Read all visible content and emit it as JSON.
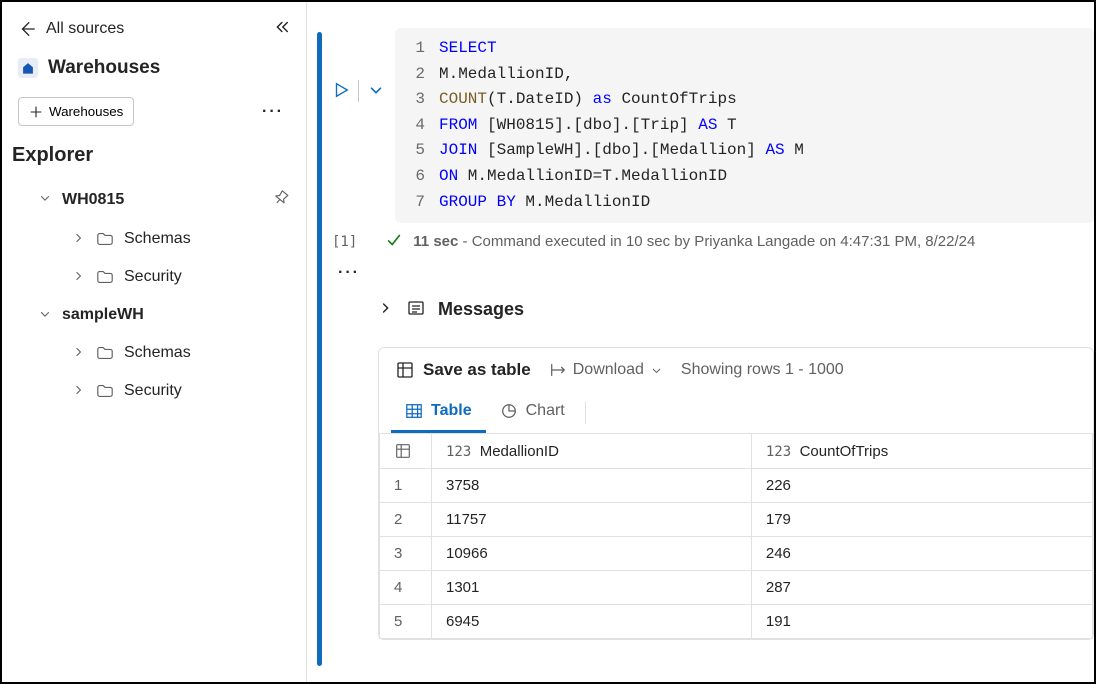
{
  "sidebar": {
    "all_sources_label": "All sources",
    "home_label": "Warehouses",
    "add_button_label": "Warehouses",
    "explorer_label": "Explorer",
    "tree": [
      {
        "name": "WH0815",
        "expanded": true,
        "children": [
          {
            "label": "Schemas"
          },
          {
            "label": "Security"
          }
        ]
      },
      {
        "name": "sampleWH",
        "expanded": true,
        "children": [
          {
            "label": "Schemas"
          },
          {
            "label": "Security"
          }
        ]
      }
    ]
  },
  "query": {
    "lines": [
      {
        "n": "1",
        "parts": [
          {
            "c": "kw",
            "t": "SELECT"
          }
        ]
      },
      {
        "n": "2",
        "parts": [
          {
            "c": "op",
            "t": "M.MedallionID,"
          }
        ]
      },
      {
        "n": "3",
        "parts": [
          {
            "c": "fn",
            "t": "COUNT"
          },
          {
            "c": "op",
            "t": "(T.DateID) "
          },
          {
            "c": "kw",
            "t": "as"
          },
          {
            "c": "op",
            "t": " CountOfTrips"
          }
        ]
      },
      {
        "n": "4",
        "parts": [
          {
            "c": "kw",
            "t": "FROM"
          },
          {
            "c": "op",
            "t": " [WH0815].[dbo].[Trip] "
          },
          {
            "c": "kw",
            "t": "AS"
          },
          {
            "c": "op",
            "t": " T"
          }
        ]
      },
      {
        "n": "5",
        "parts": [
          {
            "c": "kw",
            "t": "JOIN"
          },
          {
            "c": "op",
            "t": " [SampleWH].[dbo].[Medallion] "
          },
          {
            "c": "kw",
            "t": "AS"
          },
          {
            "c": "op",
            "t": " M"
          }
        ]
      },
      {
        "n": "6",
        "parts": [
          {
            "c": "kw",
            "t": "ON"
          },
          {
            "c": "op",
            "t": " M.MedallionID=T.MedallionID"
          }
        ]
      },
      {
        "n": "7",
        "parts": [
          {
            "c": "kw",
            "t": "GROUP BY"
          },
          {
            "c": "op",
            "t": " M.MedallionID"
          }
        ]
      }
    ],
    "cell_count": "[1]",
    "status_duration": "11 sec",
    "status_text": " - Command executed in 10 sec by Priyanka Langade on 4:47:31 PM, 8/22/24"
  },
  "results": {
    "messages_label": "Messages",
    "toolbar": {
      "save_table": "Save as table",
      "download": "Download",
      "showing": "Showing rows 1 - 1000"
    },
    "tabs": {
      "table": "Table",
      "chart": "Chart"
    },
    "columns": [
      {
        "type": "123",
        "name": "MedallionID"
      },
      {
        "type": "123",
        "name": "CountOfTrips"
      }
    ],
    "rows": [
      {
        "n": "1",
        "c": [
          "3758",
          "226"
        ]
      },
      {
        "n": "2",
        "c": [
          "11757",
          "179"
        ]
      },
      {
        "n": "3",
        "c": [
          "10966",
          "246"
        ]
      },
      {
        "n": "4",
        "c": [
          "1301",
          "287"
        ]
      },
      {
        "n": "5",
        "c": [
          "6945",
          "191"
        ]
      }
    ]
  }
}
